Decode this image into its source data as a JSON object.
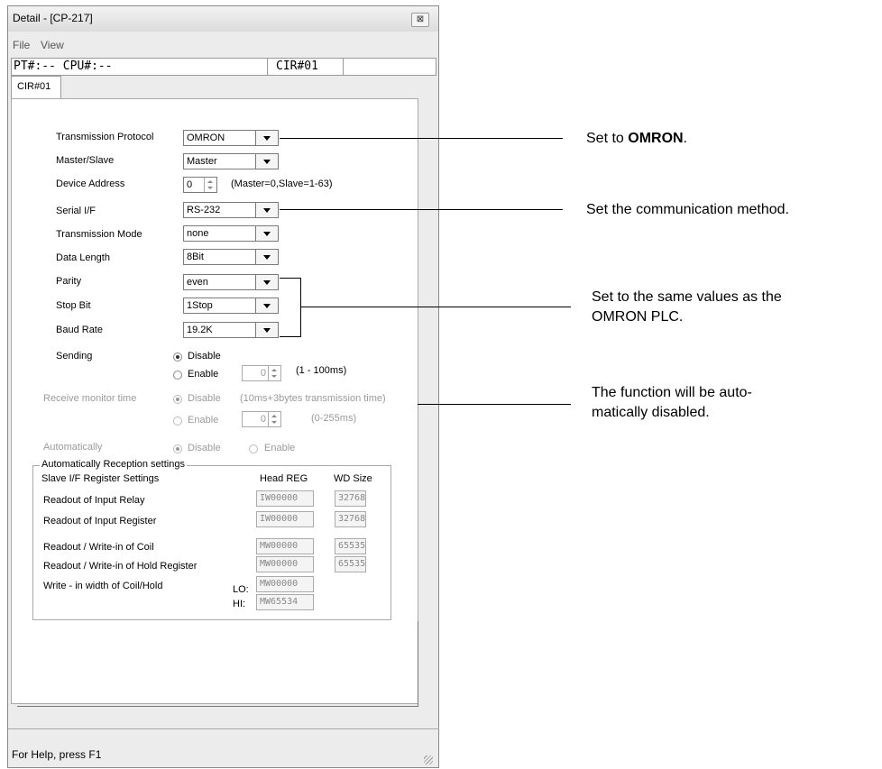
{
  "window": {
    "title": "Detail - [CP-217]",
    "close_glyph": "⊠"
  },
  "menu": [
    "File",
    "View"
  ],
  "infobar": {
    "pt_cpu": "PT#:-- CPU#:--",
    "cir": "CIR#01"
  },
  "tab": {
    "label": "CIR#01"
  },
  "settings": {
    "protocol": {
      "label": "Transmission Protocol",
      "value": "OMRON"
    },
    "master_slave": {
      "label": "Master/Slave",
      "value": "Master"
    },
    "device_address": {
      "label": "Device Address",
      "value": "0",
      "hint": "(Master=0,Slave=1-63)"
    },
    "serial_if": {
      "label": "Serial I/F",
      "value": "RS-232"
    },
    "transmission_mode": {
      "label": "Transmission Mode",
      "value": "none"
    },
    "data_length": {
      "label": "Data Length",
      "value": "8Bit"
    },
    "parity": {
      "label": "Parity",
      "value": "even"
    },
    "stop_bit": {
      "label": "Stop Bit",
      "value": "1Stop"
    },
    "baud_rate": {
      "label": "Baud Rate",
      "value": "19.2K"
    }
  },
  "sending": {
    "label": "Sending",
    "disable": "Disable",
    "enable": "Enable",
    "spin_value": "0",
    "range": "(1 - 100ms)"
  },
  "receive_monitor": {
    "label": "Receive monitor time",
    "disable": "Disable",
    "hint": "(10ms+3bytes transmission time)",
    "enable": "Enable",
    "spin_value": "0",
    "range": "(0-255ms)"
  },
  "automatically": {
    "label": "Automatically",
    "disable": "Disable",
    "enable": "Enable"
  },
  "reception": {
    "group_title": "Automatically Reception settings",
    "slave_header": "Slave I/F Register Settings",
    "head_reg_header": "Head REG",
    "wd_size_header": "WD Size",
    "rows": [
      {
        "label": "Readout of Input Relay",
        "head": "IW00000",
        "size": "32768"
      },
      {
        "label": "Readout of Input Register",
        "head": "IW00000",
        "size": "32768"
      },
      {
        "label": "Readout / Write-in of Coil",
        "head": "MW00000",
        "size": "65535"
      },
      {
        "label": "Readout / Write-in of Hold Register",
        "head": "MW00000",
        "size": "65535"
      }
    ],
    "width_label": "Write - in width of Coil/Hold",
    "lo_label": "LO:",
    "lo_value": "MW00000",
    "hi_label": "HI:",
    "hi_value": "MW65534"
  },
  "statusbar": {
    "text": "For Help, press F1"
  },
  "callouts": {
    "omron_pre": "Set to ",
    "omron_bold": "OMRON",
    "omron_post": ".",
    "comm": "Set the communication method.",
    "plc_line1": "Set to the same values as the",
    "plc_line2": "OMRON PLC.",
    "auto_line1": "The function will be auto-",
    "auto_line2": "matically disabled."
  }
}
